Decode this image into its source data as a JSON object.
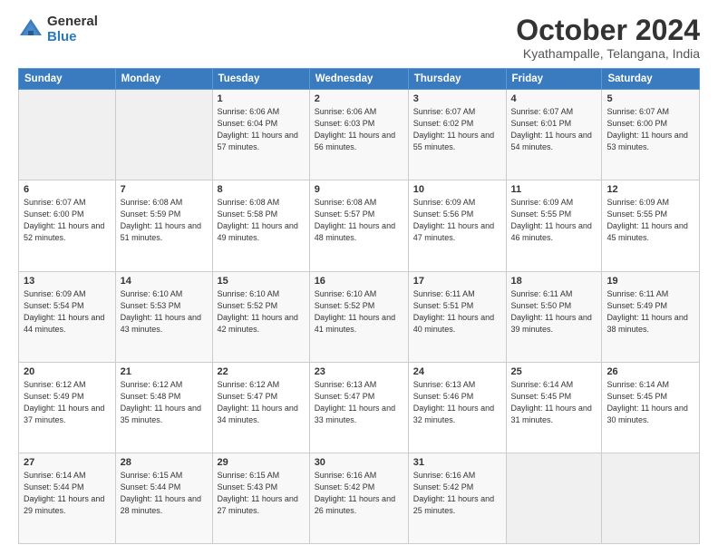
{
  "logo": {
    "general": "General",
    "blue": "Blue"
  },
  "title": "October 2024",
  "location": "Kyathampalle, Telangana, India",
  "days_header": [
    "Sunday",
    "Monday",
    "Tuesday",
    "Wednesday",
    "Thursday",
    "Friday",
    "Saturday"
  ],
  "weeks": [
    [
      {
        "day": "",
        "sunrise": "",
        "sunset": "",
        "daylight": ""
      },
      {
        "day": "",
        "sunrise": "",
        "sunset": "",
        "daylight": ""
      },
      {
        "day": "1",
        "sunrise": "Sunrise: 6:06 AM",
        "sunset": "Sunset: 6:04 PM",
        "daylight": "Daylight: 11 hours and 57 minutes."
      },
      {
        "day": "2",
        "sunrise": "Sunrise: 6:06 AM",
        "sunset": "Sunset: 6:03 PM",
        "daylight": "Daylight: 11 hours and 56 minutes."
      },
      {
        "day": "3",
        "sunrise": "Sunrise: 6:07 AM",
        "sunset": "Sunset: 6:02 PM",
        "daylight": "Daylight: 11 hours and 55 minutes."
      },
      {
        "day": "4",
        "sunrise": "Sunrise: 6:07 AM",
        "sunset": "Sunset: 6:01 PM",
        "daylight": "Daylight: 11 hours and 54 minutes."
      },
      {
        "day": "5",
        "sunrise": "Sunrise: 6:07 AM",
        "sunset": "Sunset: 6:00 PM",
        "daylight": "Daylight: 11 hours and 53 minutes."
      }
    ],
    [
      {
        "day": "6",
        "sunrise": "Sunrise: 6:07 AM",
        "sunset": "Sunset: 6:00 PM",
        "daylight": "Daylight: 11 hours and 52 minutes."
      },
      {
        "day": "7",
        "sunrise": "Sunrise: 6:08 AM",
        "sunset": "Sunset: 5:59 PM",
        "daylight": "Daylight: 11 hours and 51 minutes."
      },
      {
        "day": "8",
        "sunrise": "Sunrise: 6:08 AM",
        "sunset": "Sunset: 5:58 PM",
        "daylight": "Daylight: 11 hours and 49 minutes."
      },
      {
        "day": "9",
        "sunrise": "Sunrise: 6:08 AM",
        "sunset": "Sunset: 5:57 PM",
        "daylight": "Daylight: 11 hours and 48 minutes."
      },
      {
        "day": "10",
        "sunrise": "Sunrise: 6:09 AM",
        "sunset": "Sunset: 5:56 PM",
        "daylight": "Daylight: 11 hours and 47 minutes."
      },
      {
        "day": "11",
        "sunrise": "Sunrise: 6:09 AM",
        "sunset": "Sunset: 5:55 PM",
        "daylight": "Daylight: 11 hours and 46 minutes."
      },
      {
        "day": "12",
        "sunrise": "Sunrise: 6:09 AM",
        "sunset": "Sunset: 5:55 PM",
        "daylight": "Daylight: 11 hours and 45 minutes."
      }
    ],
    [
      {
        "day": "13",
        "sunrise": "Sunrise: 6:09 AM",
        "sunset": "Sunset: 5:54 PM",
        "daylight": "Daylight: 11 hours and 44 minutes."
      },
      {
        "day": "14",
        "sunrise": "Sunrise: 6:10 AM",
        "sunset": "Sunset: 5:53 PM",
        "daylight": "Daylight: 11 hours and 43 minutes."
      },
      {
        "day": "15",
        "sunrise": "Sunrise: 6:10 AM",
        "sunset": "Sunset: 5:52 PM",
        "daylight": "Daylight: 11 hours and 42 minutes."
      },
      {
        "day": "16",
        "sunrise": "Sunrise: 6:10 AM",
        "sunset": "Sunset: 5:52 PM",
        "daylight": "Daylight: 11 hours and 41 minutes."
      },
      {
        "day": "17",
        "sunrise": "Sunrise: 6:11 AM",
        "sunset": "Sunset: 5:51 PM",
        "daylight": "Daylight: 11 hours and 40 minutes."
      },
      {
        "day": "18",
        "sunrise": "Sunrise: 6:11 AM",
        "sunset": "Sunset: 5:50 PM",
        "daylight": "Daylight: 11 hours and 39 minutes."
      },
      {
        "day": "19",
        "sunrise": "Sunrise: 6:11 AM",
        "sunset": "Sunset: 5:49 PM",
        "daylight": "Daylight: 11 hours and 38 minutes."
      }
    ],
    [
      {
        "day": "20",
        "sunrise": "Sunrise: 6:12 AM",
        "sunset": "Sunset: 5:49 PM",
        "daylight": "Daylight: 11 hours and 37 minutes."
      },
      {
        "day": "21",
        "sunrise": "Sunrise: 6:12 AM",
        "sunset": "Sunset: 5:48 PM",
        "daylight": "Daylight: 11 hours and 35 minutes."
      },
      {
        "day": "22",
        "sunrise": "Sunrise: 6:12 AM",
        "sunset": "Sunset: 5:47 PM",
        "daylight": "Daylight: 11 hours and 34 minutes."
      },
      {
        "day": "23",
        "sunrise": "Sunrise: 6:13 AM",
        "sunset": "Sunset: 5:47 PM",
        "daylight": "Daylight: 11 hours and 33 minutes."
      },
      {
        "day": "24",
        "sunrise": "Sunrise: 6:13 AM",
        "sunset": "Sunset: 5:46 PM",
        "daylight": "Daylight: 11 hours and 32 minutes."
      },
      {
        "day": "25",
        "sunrise": "Sunrise: 6:14 AM",
        "sunset": "Sunset: 5:45 PM",
        "daylight": "Daylight: 11 hours and 31 minutes."
      },
      {
        "day": "26",
        "sunrise": "Sunrise: 6:14 AM",
        "sunset": "Sunset: 5:45 PM",
        "daylight": "Daylight: 11 hours and 30 minutes."
      }
    ],
    [
      {
        "day": "27",
        "sunrise": "Sunrise: 6:14 AM",
        "sunset": "Sunset: 5:44 PM",
        "daylight": "Daylight: 11 hours and 29 minutes."
      },
      {
        "day": "28",
        "sunrise": "Sunrise: 6:15 AM",
        "sunset": "Sunset: 5:44 PM",
        "daylight": "Daylight: 11 hours and 28 minutes."
      },
      {
        "day": "29",
        "sunrise": "Sunrise: 6:15 AM",
        "sunset": "Sunset: 5:43 PM",
        "daylight": "Daylight: 11 hours and 27 minutes."
      },
      {
        "day": "30",
        "sunrise": "Sunrise: 6:16 AM",
        "sunset": "Sunset: 5:42 PM",
        "daylight": "Daylight: 11 hours and 26 minutes."
      },
      {
        "day": "31",
        "sunrise": "Sunrise: 6:16 AM",
        "sunset": "Sunset: 5:42 PM",
        "daylight": "Daylight: 11 hours and 25 minutes."
      },
      {
        "day": "",
        "sunrise": "",
        "sunset": "",
        "daylight": ""
      },
      {
        "day": "",
        "sunrise": "",
        "sunset": "",
        "daylight": ""
      }
    ]
  ]
}
